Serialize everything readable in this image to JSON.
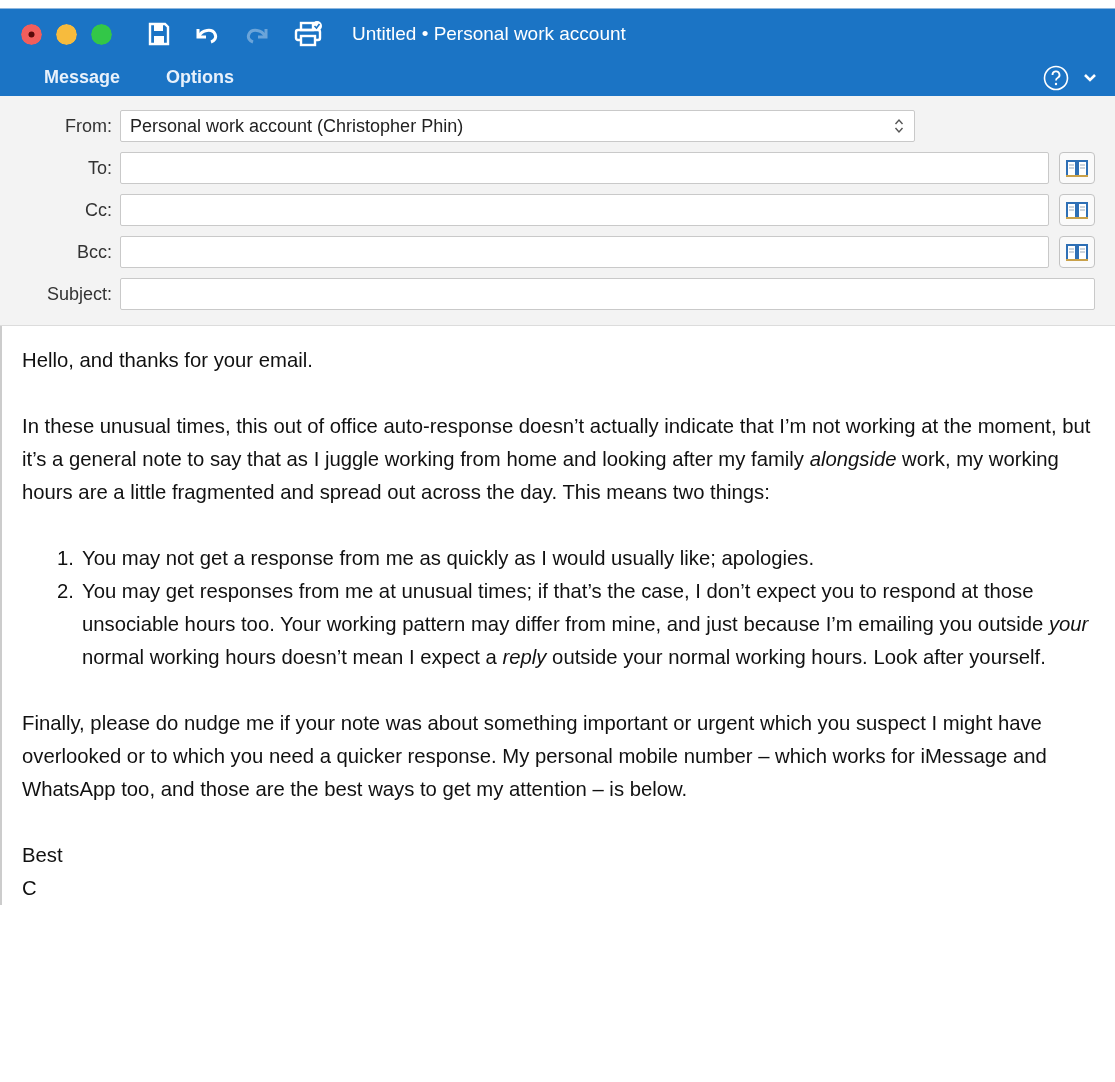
{
  "window": {
    "title": "Untitled • Personal work account"
  },
  "toolbar": [
    {
      "kind": "save",
      "disabled": false
    },
    {
      "kind": "undo",
      "disabled": false
    },
    {
      "kind": "redo",
      "disabled": true
    },
    {
      "kind": "print",
      "disabled": false
    }
  ],
  "tabs": [
    "Message",
    "Options"
  ],
  "from": {
    "label": "From:",
    "value": "Personal work account (Christopher Phin)"
  },
  "recipients": [
    {
      "label": "To:"
    },
    {
      "label": "Cc:"
    },
    {
      "label": "Bcc:"
    }
  ],
  "subject": {
    "label": "Subject:"
  },
  "body": [
    {
      "kind": "paragraph",
      "text": "Hello, and thanks for your email."
    },
    {
      "kind": "paragraph",
      "text": "In these unusual times, this out of office auto-response doesn’t actually indicate that I’m not working at the moment, but it’s a general note to say that as I juggle working from home and looking after my family *alongside* work, my working hours are a little fragmented and spread out across the day. This means two things:"
    },
    {
      "kind": "list",
      "items": [
        {
          "number": "1.",
          "text": "You may not get a response from me as quickly as I would usually like; apologies."
        },
        {
          "number": "2.",
          "text": "You may get responses from me at unusual times; if that’s the case, I don’t expect you to respond at those unsociable hours too. Your working pattern may differ from mine, and just because I’m emailing you outside *your* normal working hours doesn’t mean I expect a *reply* outside your normal working hours. Look after yourself."
        }
      ]
    },
    {
      "kind": "paragraph",
      "text": "Finally, please do nudge me if your note was about something important or urgent which you suspect I might have overlooked or to which you need a quicker response. My personal mobile number – which works for iMessage and WhatsApp too, and those are the best ways to get my attention – is below."
    },
    {
      "kind": "lines",
      "lines": [
        "Best",
        "C"
      ]
    }
  ]
}
